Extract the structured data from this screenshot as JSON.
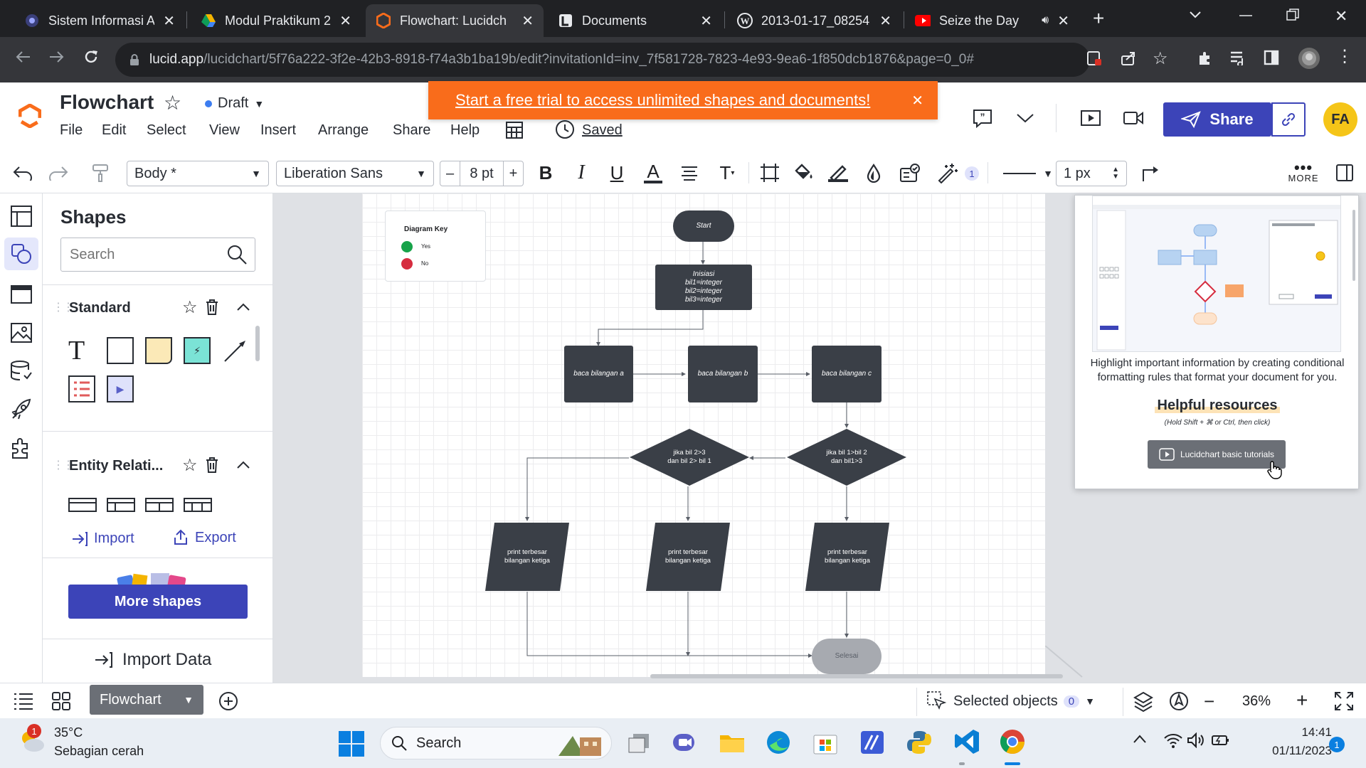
{
  "browser": {
    "tabs": [
      {
        "title": "Sistem Informasi A",
        "color": "#3a3f7a"
      },
      {
        "title": "Modul Praktikum 2",
        "color": "#f4b400"
      },
      {
        "title": "Flowchart: Lucidch",
        "color": "#f96c1b"
      },
      {
        "title": "Documents",
        "color": "#e8eaed"
      },
      {
        "title": "2013-01-17_08254",
        "color": "#e8eaed"
      },
      {
        "title": "Seize the Day",
        "color": "#ff0000"
      }
    ],
    "url_host": "lucid.app",
    "url_path": "/lucidchart/5f76a222-3f2e-42b3-8918-f74a3b1ba19b/edit?invitationId=inv_7f581728-7823-4e93-9ea6-1f850dcb1876&page=0_0#"
  },
  "app": {
    "doc_title": "Flowchart",
    "status": "Draft",
    "menus": [
      "File",
      "Edit",
      "Select",
      "View",
      "Insert",
      "Arrange",
      "Share",
      "Help"
    ],
    "saved": "Saved",
    "banner": "Start a free trial to access unlimited shapes and documents!",
    "share": "Share",
    "avatar": "FA",
    "brand_color": "#f96c1b",
    "accent": "#3c44b8"
  },
  "toolbar": {
    "style": "Body *",
    "font": "Liberation Sans",
    "size": "8 pt",
    "line_width": "1 px",
    "more": "MORE",
    "badge": "1"
  },
  "shapes_panel": {
    "title": "Shapes",
    "search_placeholder": "Search",
    "standard": "Standard",
    "entity": "Entity Relati...",
    "import": "Import",
    "export": "Export",
    "more_shapes": "More shapes",
    "import_data": "Import Data"
  },
  "diagram": {
    "key_title": "Diagram Key",
    "key_yes": "Yes",
    "key_no": "No",
    "start": "Start",
    "init": "Inisiasi\nbil1=integer\nbil2=integer\nbil3=integer",
    "read_a": "baca bilangan a",
    "read_b": "baca bilangan b",
    "read_c": "baca bilangan c",
    "cond1": "jika bil 2>3\ndan bil 2> bil  1",
    "cond2": "jika bil 1>bil 2\ndan bil1>3",
    "print1": "print terbesar\nbilangan ketiga",
    "print2": "print terbesar\nbilangan ketiga",
    "print3": "print terbesar\nbilangan ketiga",
    "end": "Selesai"
  },
  "help_panel": {
    "text": "Highlight important information by creating conditional formatting rules that format your document for you.",
    "heading": "Helpful resources",
    "hint": "(Hold Shift + ⌘ or Ctrl, then click)",
    "button": "Lucidchart basic tutorials"
  },
  "bottom": {
    "page_tab": "Flowchart",
    "selected": "Selected objects",
    "selected_count": "0",
    "zoom": "36%"
  },
  "taskbar": {
    "temp": "35°C",
    "weather": "Sebagian cerah",
    "weather_badge": "1",
    "search": "Search",
    "time": "14:41",
    "date": "01/11/2023",
    "notif": "1"
  }
}
